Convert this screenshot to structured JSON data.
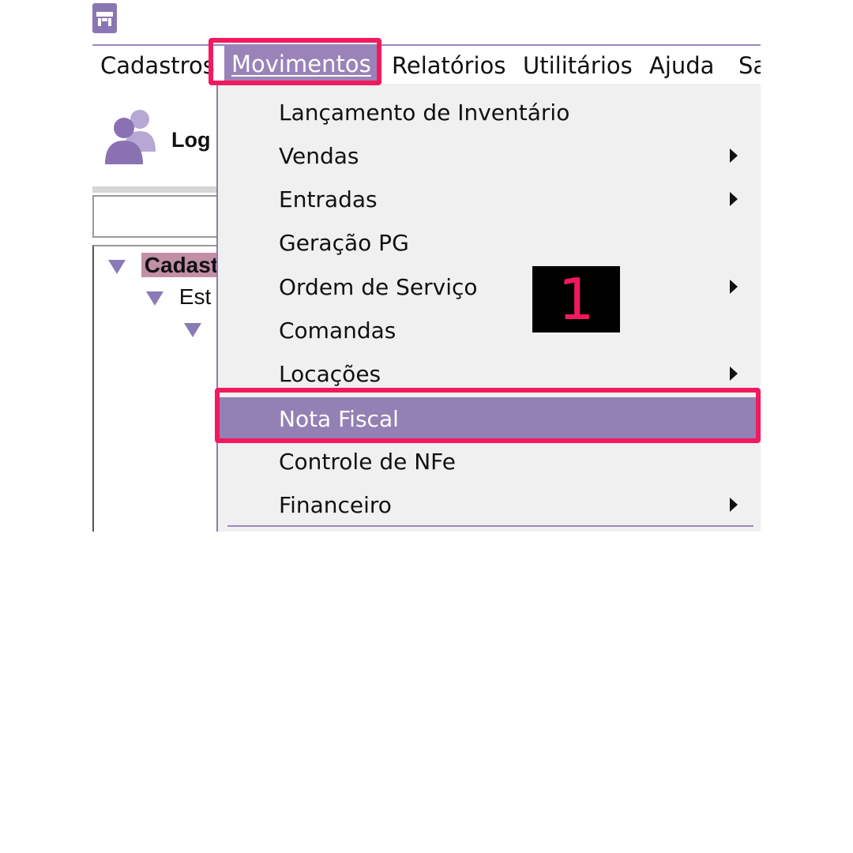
{
  "menubar": {
    "items": [
      "Cadastros",
      "Movimentos",
      "Relatórios",
      "Utilitários",
      "Ajuda",
      "Sa"
    ]
  },
  "login": {
    "label": "Log"
  },
  "tree": {
    "root": "Cadast",
    "child": "Est"
  },
  "dropdown": {
    "items": [
      {
        "label": "Lançamento de Inventário",
        "submenu": false
      },
      {
        "label": "Vendas",
        "submenu": true
      },
      {
        "label": "Entradas",
        "submenu": true
      },
      {
        "label": "Geração PG",
        "submenu": false
      },
      {
        "label": "Ordem de Serviço",
        "submenu": true
      },
      {
        "label": "Comandas",
        "submenu": false
      },
      {
        "label": "Locações",
        "submenu": true
      },
      {
        "label": "Nota Fiscal",
        "submenu": false
      },
      {
        "label": "Controle de NFe",
        "submenu": false
      },
      {
        "label": "Financeiro",
        "submenu": true
      }
    ],
    "selected": "Nota Fiscal"
  },
  "annotation": {
    "step_number": "1"
  },
  "colors": {
    "accent": "#9380b4",
    "highlight_border": "#f2195f",
    "menu_background": "#f0f0f0"
  }
}
